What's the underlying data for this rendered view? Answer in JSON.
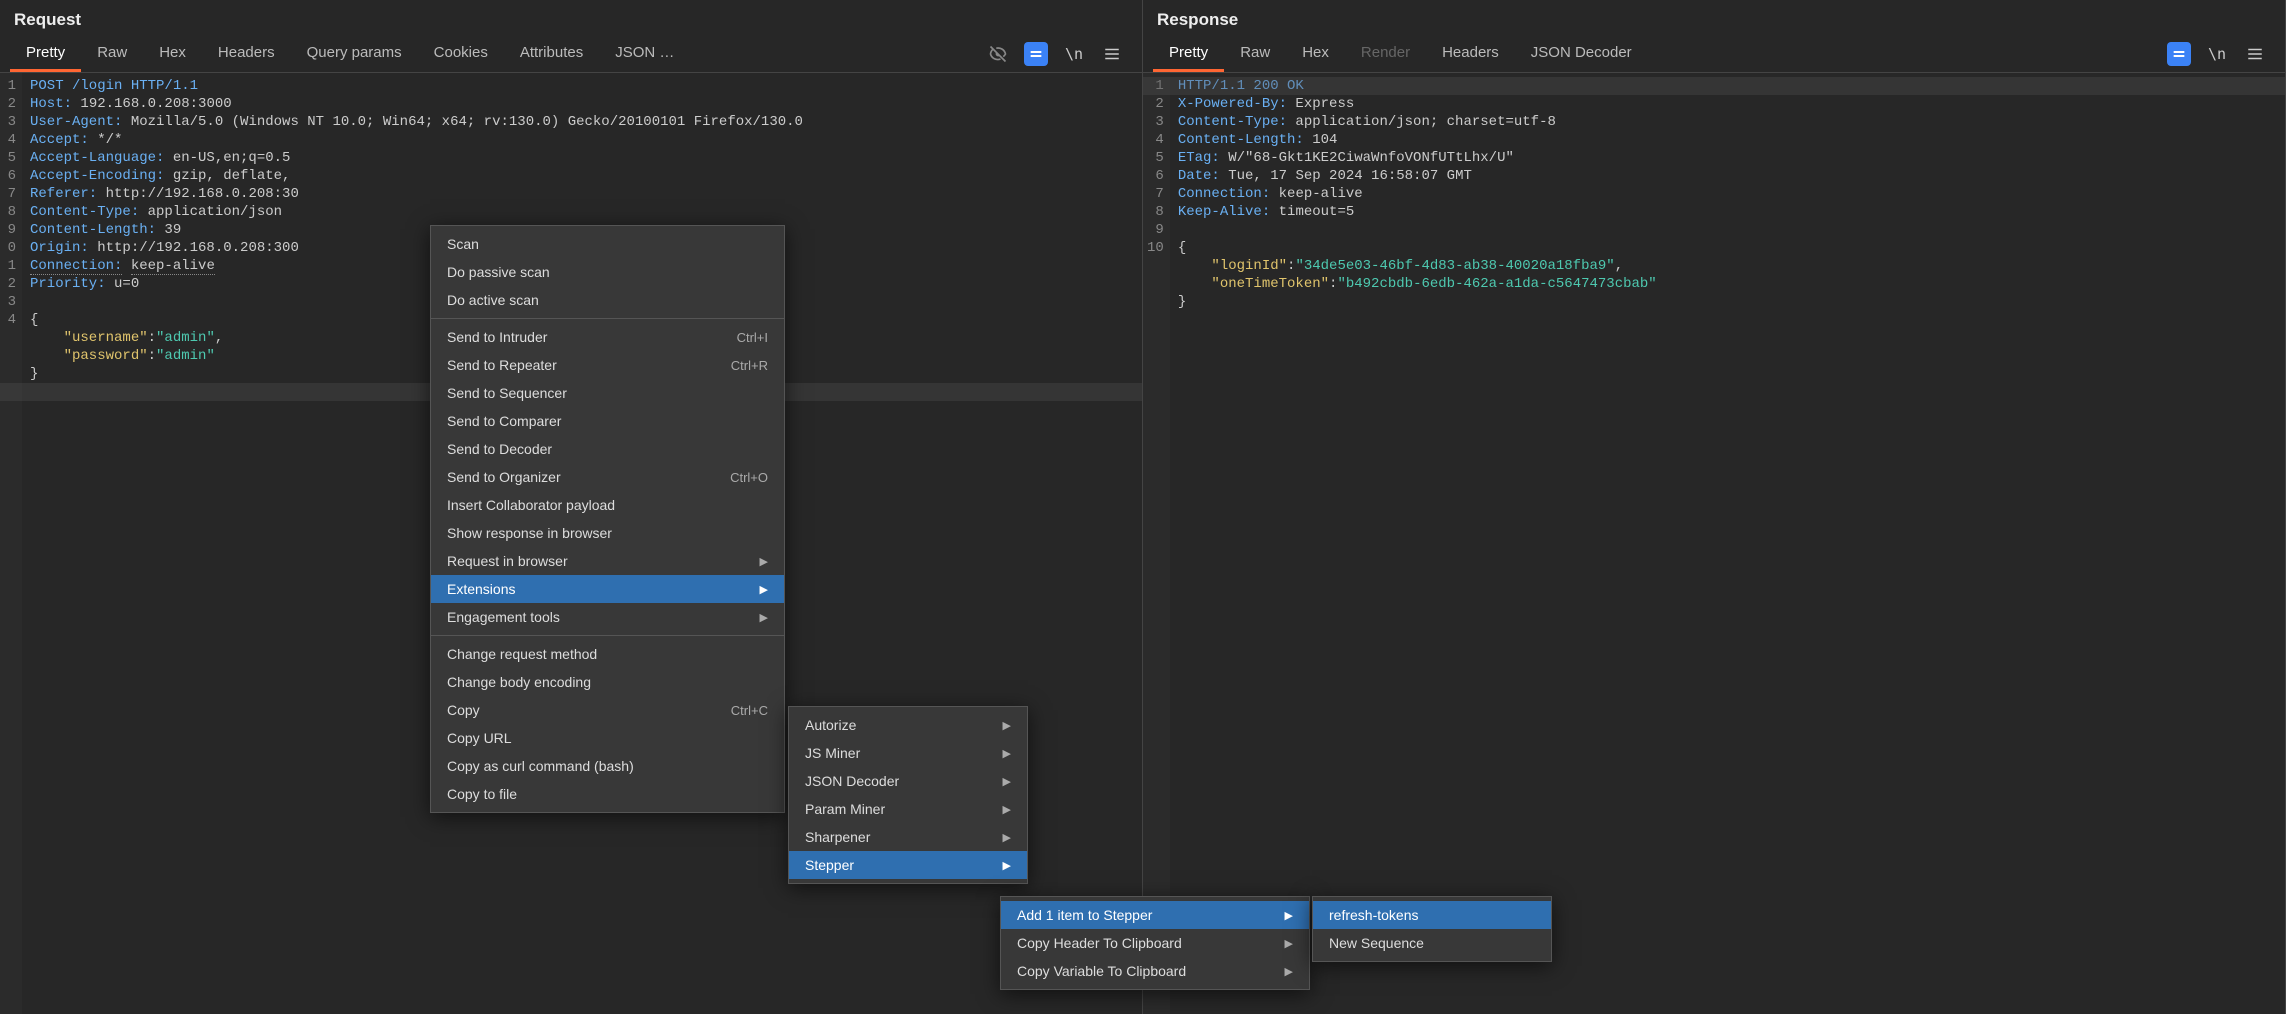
{
  "request": {
    "title": "Request",
    "tabs": [
      "Pretty",
      "Raw",
      "Hex",
      "Headers",
      "Query params",
      "Cookies",
      "Attributes",
      "JSON …"
    ],
    "active_tab_index": 0,
    "lines": [
      {
        "n": "1",
        "seg": [
          {
            "t": "POST /login HTTP/1.1",
            "c": "kw"
          }
        ]
      },
      {
        "n": "2",
        "seg": [
          {
            "t": "Host:",
            "c": "hdr"
          },
          {
            "t": " 192.168.0.208:3000",
            "c": "val"
          }
        ]
      },
      {
        "n": "3",
        "seg": [
          {
            "t": "User-Agent:",
            "c": "hdr"
          },
          {
            "t": " Mozilla/5.0 (Windows NT 10.0; Win64; x64; rv:130.0) Gecko/20100101 Firefox/130.0",
            "c": "val"
          }
        ]
      },
      {
        "n": "4",
        "seg": [
          {
            "t": "Accept:",
            "c": "hdr"
          },
          {
            "t": " */*",
            "c": "val"
          }
        ]
      },
      {
        "n": "5",
        "seg": [
          {
            "t": "Accept-Language:",
            "c": "hdr"
          },
          {
            "t": " en-US,en;q=0.5",
            "c": "val"
          }
        ]
      },
      {
        "n": "6",
        "seg": [
          {
            "t": "Accept-Encoding:",
            "c": "hdr"
          },
          {
            "t": " gzip, deflate,",
            "c": "val"
          }
        ]
      },
      {
        "n": "7",
        "seg": [
          {
            "t": "Referer:",
            "c": "hdr"
          },
          {
            "t": " http://192.168.0.208:30",
            "c": "val"
          }
        ]
      },
      {
        "n": "8",
        "seg": [
          {
            "t": "Content-Type:",
            "c": "hdr"
          },
          {
            "t": " application/json",
            "c": "val"
          }
        ]
      },
      {
        "n": "9",
        "seg": [
          {
            "t": "Content-Length:",
            "c": "hdr"
          },
          {
            "t": " 39",
            "c": "val"
          }
        ]
      },
      {
        "n": "0",
        "seg": [
          {
            "t": "Origin:",
            "c": "hdr"
          },
          {
            "t": " http://192.168.0.208:300",
            "c": "val"
          }
        ]
      },
      {
        "n": "1",
        "seg": [
          {
            "t": "Connection:",
            "c": "hdr dotted"
          },
          {
            "t": " ",
            "c": ""
          },
          {
            "t": "keep-alive",
            "c": "val dotted"
          }
        ]
      },
      {
        "n": "2",
        "seg": [
          {
            "t": "Priority:",
            "c": "hdr"
          },
          {
            "t": " u=0",
            "c": "val"
          }
        ]
      },
      {
        "n": "3",
        "seg": [
          {
            "t": "",
            "c": ""
          }
        ]
      },
      {
        "n": "4",
        "seg": [
          {
            "t": "{",
            "c": ""
          }
        ]
      },
      {
        "n": "",
        "seg": [
          {
            "t": "    \"username\"",
            "c": "jkey"
          },
          {
            "t": ":",
            "c": ""
          },
          {
            "t": "\"admin\"",
            "c": "jstr"
          },
          {
            "t": ",",
            "c": ""
          }
        ]
      },
      {
        "n": "",
        "seg": [
          {
            "t": "    \"password\"",
            "c": "jkey"
          },
          {
            "t": ":",
            "c": ""
          },
          {
            "t": "\"admin\"",
            "c": "jstr"
          }
        ]
      },
      {
        "n": "",
        "seg": [
          {
            "t": "}",
            "c": ""
          }
        ]
      }
    ]
  },
  "response": {
    "title": "Response",
    "tabs": [
      "Pretty",
      "Raw",
      "Hex",
      "Render",
      "Headers",
      "JSON Decoder"
    ],
    "active_tab_index": 0,
    "disabled_tab_index": 3,
    "lines": [
      {
        "n": "1",
        "seg": [
          {
            "t": "HTTP/1.1 200 OK",
            "c": "kw"
          }
        ]
      },
      {
        "n": "2",
        "seg": [
          {
            "t": "X-Powered-By:",
            "c": "hdr"
          },
          {
            "t": " Express",
            "c": "val"
          }
        ]
      },
      {
        "n": "3",
        "seg": [
          {
            "t": "Content-Type:",
            "c": "hdr"
          },
          {
            "t": " application/json; charset=utf-8",
            "c": "val"
          }
        ]
      },
      {
        "n": "4",
        "seg": [
          {
            "t": "Content-Length:",
            "c": "hdr"
          },
          {
            "t": " 104",
            "c": "val"
          }
        ]
      },
      {
        "n": "5",
        "seg": [
          {
            "t": "ETag:",
            "c": "hdr"
          },
          {
            "t": " W/\"68-Gkt1KE2CiwaWnfoVONfUTtLhx/U\"",
            "c": "val"
          }
        ]
      },
      {
        "n": "6",
        "seg": [
          {
            "t": "Date:",
            "c": "hdr"
          },
          {
            "t": " Tue, 17 Sep 2024 16:58:07 GMT",
            "c": "val"
          }
        ]
      },
      {
        "n": "7",
        "seg": [
          {
            "t": "Connection:",
            "c": "hdr"
          },
          {
            "t": " keep-alive",
            "c": "val"
          }
        ]
      },
      {
        "n": "8",
        "seg": [
          {
            "t": "Keep-Alive:",
            "c": "hdr"
          },
          {
            "t": " timeout=5",
            "c": "val"
          }
        ]
      },
      {
        "n": "9",
        "seg": [
          {
            "t": "",
            "c": ""
          }
        ]
      },
      {
        "n": "10",
        "seg": [
          {
            "t": "{",
            "c": ""
          }
        ]
      },
      {
        "n": "",
        "seg": [
          {
            "t": "    \"loginId\"",
            "c": "jkey"
          },
          {
            "t": ":",
            "c": ""
          },
          {
            "t": "\"34de5e03-46bf-4d83-ab38-40020a18fba9\"",
            "c": "jstr"
          },
          {
            "t": ",",
            "c": ""
          }
        ]
      },
      {
        "n": "",
        "seg": [
          {
            "t": "    \"oneTimeToken\"",
            "c": "jkey"
          },
          {
            "t": ":",
            "c": ""
          },
          {
            "t": "\"b492cbdb-6edb-462a-a1da-c5647473cbab\"",
            "c": "jstr"
          }
        ]
      },
      {
        "n": "",
        "seg": [
          {
            "t": "}",
            "c": ""
          }
        ]
      }
    ]
  },
  "context_menu": {
    "items": [
      {
        "label": "Scan"
      },
      {
        "label": "Do passive scan"
      },
      {
        "label": "Do active scan"
      },
      {
        "sep": true
      },
      {
        "label": "Send to Intruder",
        "shortcut": "Ctrl+I"
      },
      {
        "label": "Send to Repeater",
        "shortcut": "Ctrl+R"
      },
      {
        "label": "Send to Sequencer"
      },
      {
        "label": "Send to Comparer"
      },
      {
        "label": "Send to Decoder"
      },
      {
        "label": "Send to Organizer",
        "shortcut": "Ctrl+O"
      },
      {
        "label": "Insert Collaborator payload"
      },
      {
        "label": "Show response in browser"
      },
      {
        "label": "Request in browser",
        "submenu": true
      },
      {
        "label": "Extensions",
        "submenu": true,
        "hovered": true
      },
      {
        "label": "Engagement tools",
        "submenu": true
      },
      {
        "sep": true
      },
      {
        "label": "Change request method"
      },
      {
        "label": "Change body encoding"
      },
      {
        "label": "Copy",
        "shortcut": "Ctrl+C"
      },
      {
        "label": "Copy URL"
      },
      {
        "label": "Copy as curl command (bash)"
      },
      {
        "label": "Copy to file"
      }
    ]
  },
  "extensions_submenu": {
    "items": [
      {
        "label": "Autorize",
        "submenu": true
      },
      {
        "label": "JS Miner",
        "submenu": true
      },
      {
        "label": "JSON Decoder",
        "submenu": true
      },
      {
        "label": "Param Miner",
        "submenu": true
      },
      {
        "label": "Sharpener",
        "submenu": true
      },
      {
        "label": "Stepper",
        "submenu": true,
        "hovered": true
      }
    ]
  },
  "stepper_submenu": {
    "items": [
      {
        "label": "Add 1 item to Stepper",
        "submenu": true,
        "hovered": true
      },
      {
        "label": "Copy Header To Clipboard",
        "submenu": true
      },
      {
        "label": "Copy Variable To Clipboard",
        "submenu": true
      }
    ]
  },
  "final_submenu": {
    "items": [
      {
        "label": "refresh-tokens",
        "hovered": true
      },
      {
        "label": "New Sequence"
      }
    ]
  },
  "icons": {
    "eye_off": "eye-off-icon",
    "equals": "toggle-icon",
    "newline": "newline-icon",
    "hamburger": "hamburger-icon"
  }
}
